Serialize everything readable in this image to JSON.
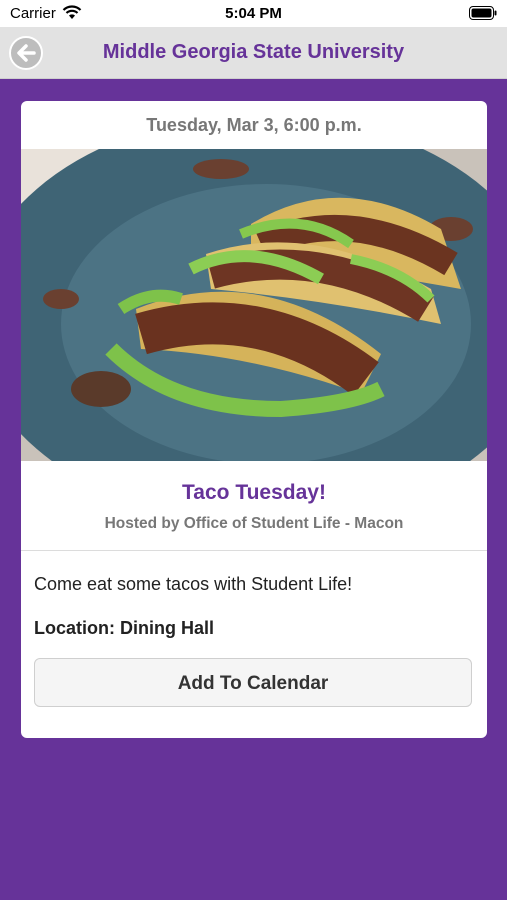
{
  "status_bar": {
    "carrier": "Carrier",
    "time": "5:04 PM"
  },
  "nav": {
    "title": "Middle Georgia State University",
    "back_icon": "back-arrow-icon"
  },
  "event": {
    "date": "Tuesday, Mar 3, 6:00 p.m.",
    "title": "Taco Tuesday!",
    "host": "Hosted by Office of Student Life - Macon",
    "description": "Come eat some tacos with Student Life!",
    "location": "Location: Dining Hall",
    "add_to_calendar_label": "Add To Calendar"
  },
  "colors": {
    "brand": "#663399",
    "nav_bg": "#e2e2e2",
    "muted_text": "#777777"
  }
}
